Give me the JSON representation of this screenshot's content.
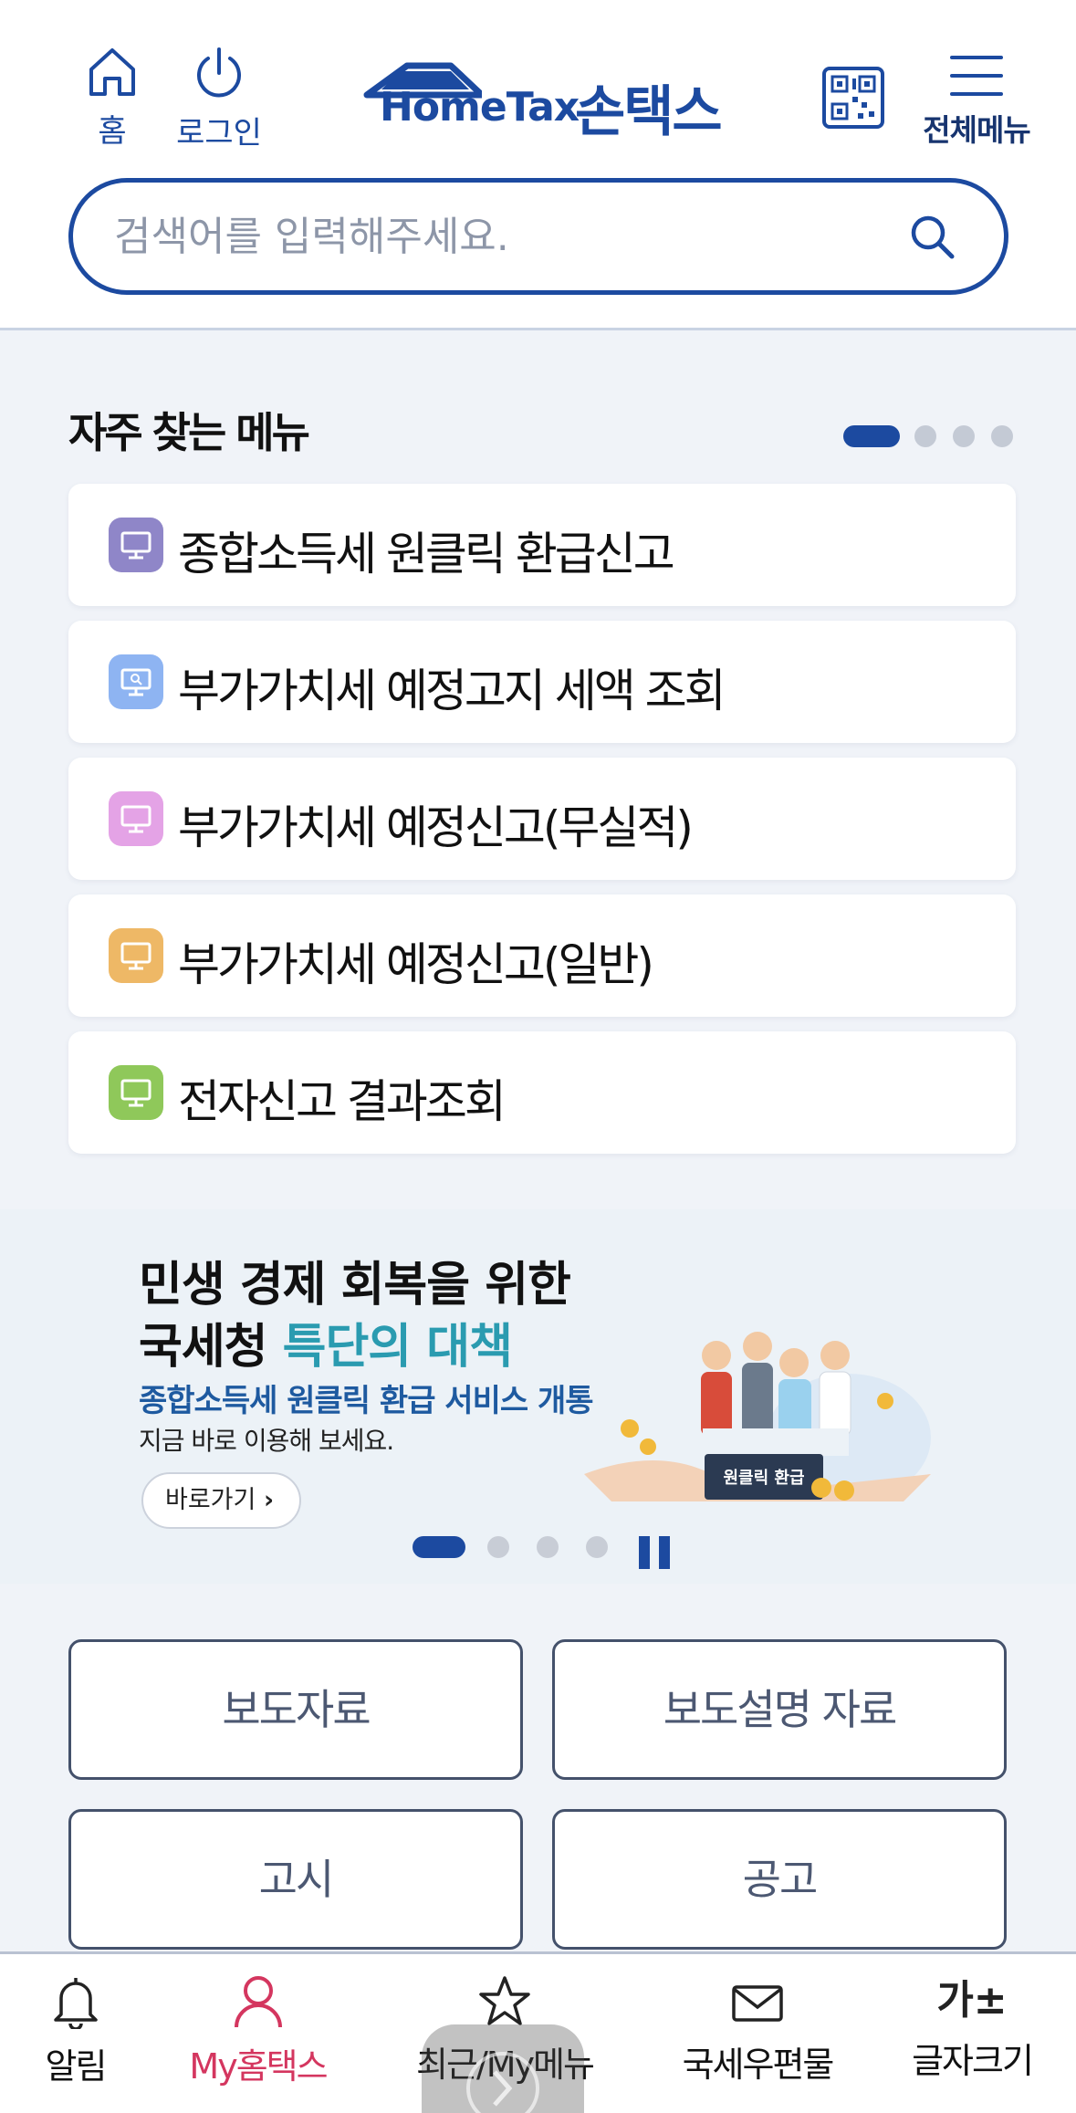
{
  "header": {
    "home_label": "홈",
    "login_label": "로그인",
    "logo_text": "HomeTax",
    "logo_sub": "손택스",
    "menu_label": "전체메뉴",
    "icons": [
      "home-icon",
      "power-icon",
      "qr-code-icon",
      "hamburger-menu-icon"
    ]
  },
  "search": {
    "placeholder": "검색어를 입력해주세요."
  },
  "frequent": {
    "title": "자주 찾는 메뉴",
    "pager": {
      "pages": 4,
      "active": 1
    },
    "items": [
      {
        "label": "종합소득세 원클릭 환급신고",
        "color": "#8f86c8",
        "icon": "monitor-icon"
      },
      {
        "label": "부가가치세 예정고지 세액 조회",
        "color": "#8eb4f2",
        "icon": "monitor-search-icon"
      },
      {
        "label": "부가가치세 예정신고(무실적)",
        "color": "#e4a3e6",
        "icon": "monitor-icon"
      },
      {
        "label": "부가가치세 예정신고(일반)",
        "color": "#eeb866",
        "icon": "monitor-icon"
      },
      {
        "label": "전자신고 결과조회",
        "color": "#8fc85a",
        "icon": "monitor-icon"
      }
    ]
  },
  "banner": {
    "line1": "민생 경제 회복을 위한",
    "line2_a": "국세청 ",
    "line2_b": "특단의 대책",
    "line3": "종합소득세 원클릭 환급 서비스 개통",
    "line4": "지금 바로 이용해 보세요.",
    "go_label": "바로가기",
    "art_label": "원클릭 환급",
    "pager": {
      "pages": 4,
      "active": 1
    }
  },
  "links": {
    "press": "보도자료",
    "press_explain": "보도설명 자료",
    "notice": "고시",
    "announce": "공고"
  },
  "bottom_nav": [
    {
      "label": "알림",
      "icon": "bell-icon"
    },
    {
      "label": "My홈택스",
      "icon": "person-icon",
      "active": true
    },
    {
      "label": "최근/My메뉴",
      "icon": "star-icon"
    },
    {
      "label": "국세우편물",
      "icon": "envelope-icon"
    },
    {
      "label": "글자크기",
      "icon": "font-size-icon",
      "glyph": "가±"
    }
  ],
  "colors": {
    "brand": "#1c4aa0",
    "active_nav": "#d4365f",
    "background": "#f0f3f8"
  }
}
